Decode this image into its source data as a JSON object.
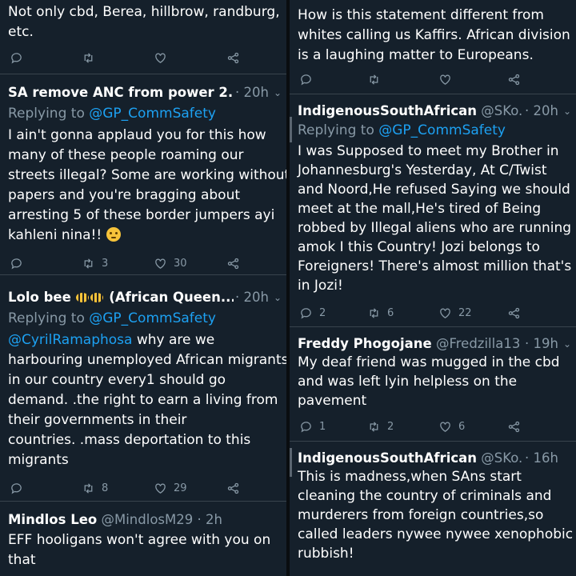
{
  "left": {
    "t0": {
      "lines": [
        "Not only cbd, Berea, hillbrow, randburg,",
        "etc."
      ],
      "reply_count": "",
      "retweet_count": "",
      "like_count": ""
    },
    "t1": {
      "name": "SA remove ANC from power 2...",
      "handle": "",
      "time": "· 20h",
      "replying_prefix": "Replying to ",
      "replying_to": "@GP_CommSafety",
      "lines": [
        "I ain't gonna applaud you for this how",
        "many of these people roaming our",
        "streets illegal? Some are working without",
        "papers and you're bragging about",
        "arresting 5 of these border jumpers ayi",
        "kahleni nina!!"
      ],
      "reply_count": "",
      "retweet_count": "3",
      "like_count": "30"
    },
    "t2": {
      "name": "Lolo bee",
      "name_suffix": "(African Queen...",
      "time": "· 20h",
      "replying_prefix": "Replying to ",
      "replying_to": "@GP_CommSafety",
      "mention": "@CyrilRamaphosa",
      "first_line_rest": " why are we",
      "lines": [
        "harbouring unemployed African migrants",
        "in our country every1 should go",
        "demand. .the right to earn a living from",
        "their governments in their",
        "countries. .mass deportation to this",
        "migrants"
      ],
      "reply_count": "",
      "retweet_count": "8",
      "like_count": "29"
    },
    "t3": {
      "name": "Mindlos Leo",
      "handle": "@MindlosM29",
      "time": "· 2h",
      "lines": [
        "EFF hooligans won't agree with you on",
        "that"
      ]
    }
  },
  "right": {
    "t0": {
      "lines": [
        "How is this statement different from",
        "whites calling us Kaffirs. African division",
        "is a laughing matter to Europeans."
      ],
      "reply_count": "",
      "retweet_count": "",
      "like_count": ""
    },
    "t1": {
      "name": "IndigenousSouthAfrican",
      "handle": "@SKo...",
      "time": "· 20h",
      "replying_prefix": "Replying to ",
      "replying_to": "@GP_CommSafety",
      "lines": [
        "I was Supposed to meet my Brother in",
        "Johannesburg's Yesterday, At C/Twist",
        "and Noord,He refused Saying we should",
        "meet at the mall,He's tired of Being",
        "robbed by Illegal aliens who are running",
        "amok I this Country! Jozi belongs to",
        "Foreigners! There's almost million that's",
        "in Jozi!"
      ],
      "reply_count": "2",
      "retweet_count": "6",
      "like_count": "22"
    },
    "t2": {
      "name": "Freddy Phogojane",
      "handle": "@Fredzilla13",
      "time": "· 19h",
      "lines": [
        "My deaf friend was mugged in the cbd",
        "and was left lyin helpless on the",
        "pavement"
      ],
      "reply_count": "1",
      "retweet_count": "2",
      "like_count": "6"
    },
    "t3": {
      "name": "IndigenousSouthAfrican",
      "handle": "@SKo...",
      "time": "· 16h",
      "lines": [
        "This is madness,when SAns start",
        "cleaning the country of criminals and",
        "murderers from foreign countries,so",
        "called leaders nywee nywee xenophobic",
        "rubbish!"
      ]
    }
  },
  "colors": {
    "background": "#15202b",
    "text": "#ffffff",
    "muted": "#8899a6",
    "link": "#1da1f2",
    "divider": "#38444d"
  },
  "icons": [
    "reply-icon",
    "retweet-icon",
    "like-icon",
    "share-icon",
    "caret-down-icon",
    "thinking-emoji-icon",
    "bee-emoji-icon"
  ]
}
